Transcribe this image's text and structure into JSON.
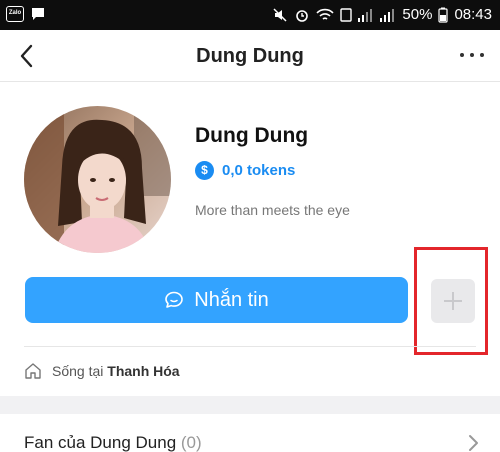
{
  "status_bar": {
    "app_badge": "Zalo",
    "battery_percent": "50%",
    "time": "08:43"
  },
  "header": {
    "title": "Dung Dung",
    "back_icon": "back-arrow-icon",
    "more_icon": "more-dots-icon"
  },
  "profile": {
    "name": "Dung Dung",
    "tokens": "0,0 tokens",
    "token_icon_symbol": "$",
    "bio": "More than meets the eye"
  },
  "actions": {
    "message_label": "Nhắn tin",
    "message_icon": "chat-bubble-icon",
    "add_icon": "plus-icon"
  },
  "location": {
    "prefix": "Sống tại",
    "city": "Thanh Hóa"
  },
  "fans": {
    "label": "Fan của Dung Dung",
    "count": "(0)"
  },
  "colors": {
    "accent": "#33a3ff",
    "token_blue": "#1a8cf2",
    "highlight": "#e3262b"
  }
}
